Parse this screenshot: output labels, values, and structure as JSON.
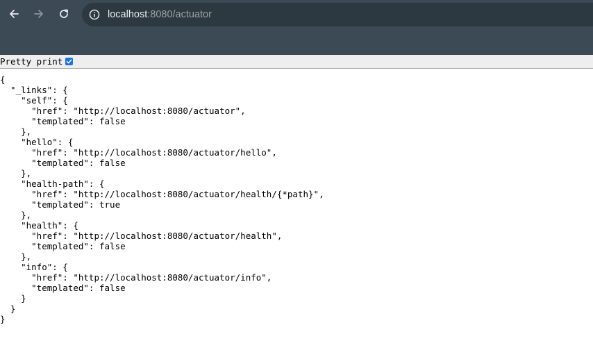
{
  "browser": {
    "url_host": "localhost",
    "url_rest": ":8080/actuator",
    "icons": {
      "back": "arrow-left-icon",
      "forward": "arrow-right-icon",
      "reload": "reload-icon",
      "site_info": "info-circle-icon",
      "checkbox": "checkmark-icon"
    },
    "colors": {
      "toolbar": "#3c4a55",
      "omnibox": "#2d3940",
      "checkbox": "#1a73e8"
    }
  },
  "viewer": {
    "pretty_print_label": "Pretty print",
    "pretty_print_checked": true,
    "lines": [
      "{",
      "  \"_links\": {",
      "    \"self\": {",
      "      \"href\": \"http://localhost:8080/actuator\",",
      "      \"templated\": false",
      "    },",
      "    \"hello\": {",
      "      \"href\": \"http://localhost:8080/actuator/hello\",",
      "      \"templated\": false",
      "    },",
      "    \"health-path\": {",
      "      \"href\": \"http://localhost:8080/actuator/health/{*path}\",",
      "      \"templated\": true",
      "    },",
      "    \"health\": {",
      "      \"href\": \"http://localhost:8080/actuator/health\",",
      "      \"templated\": false",
      "    },",
      "    \"info\": {",
      "      \"href\": \"http://localhost:8080/actuator/info\",",
      "      \"templated\": false",
      "    }",
      "  }",
      "}"
    ]
  }
}
